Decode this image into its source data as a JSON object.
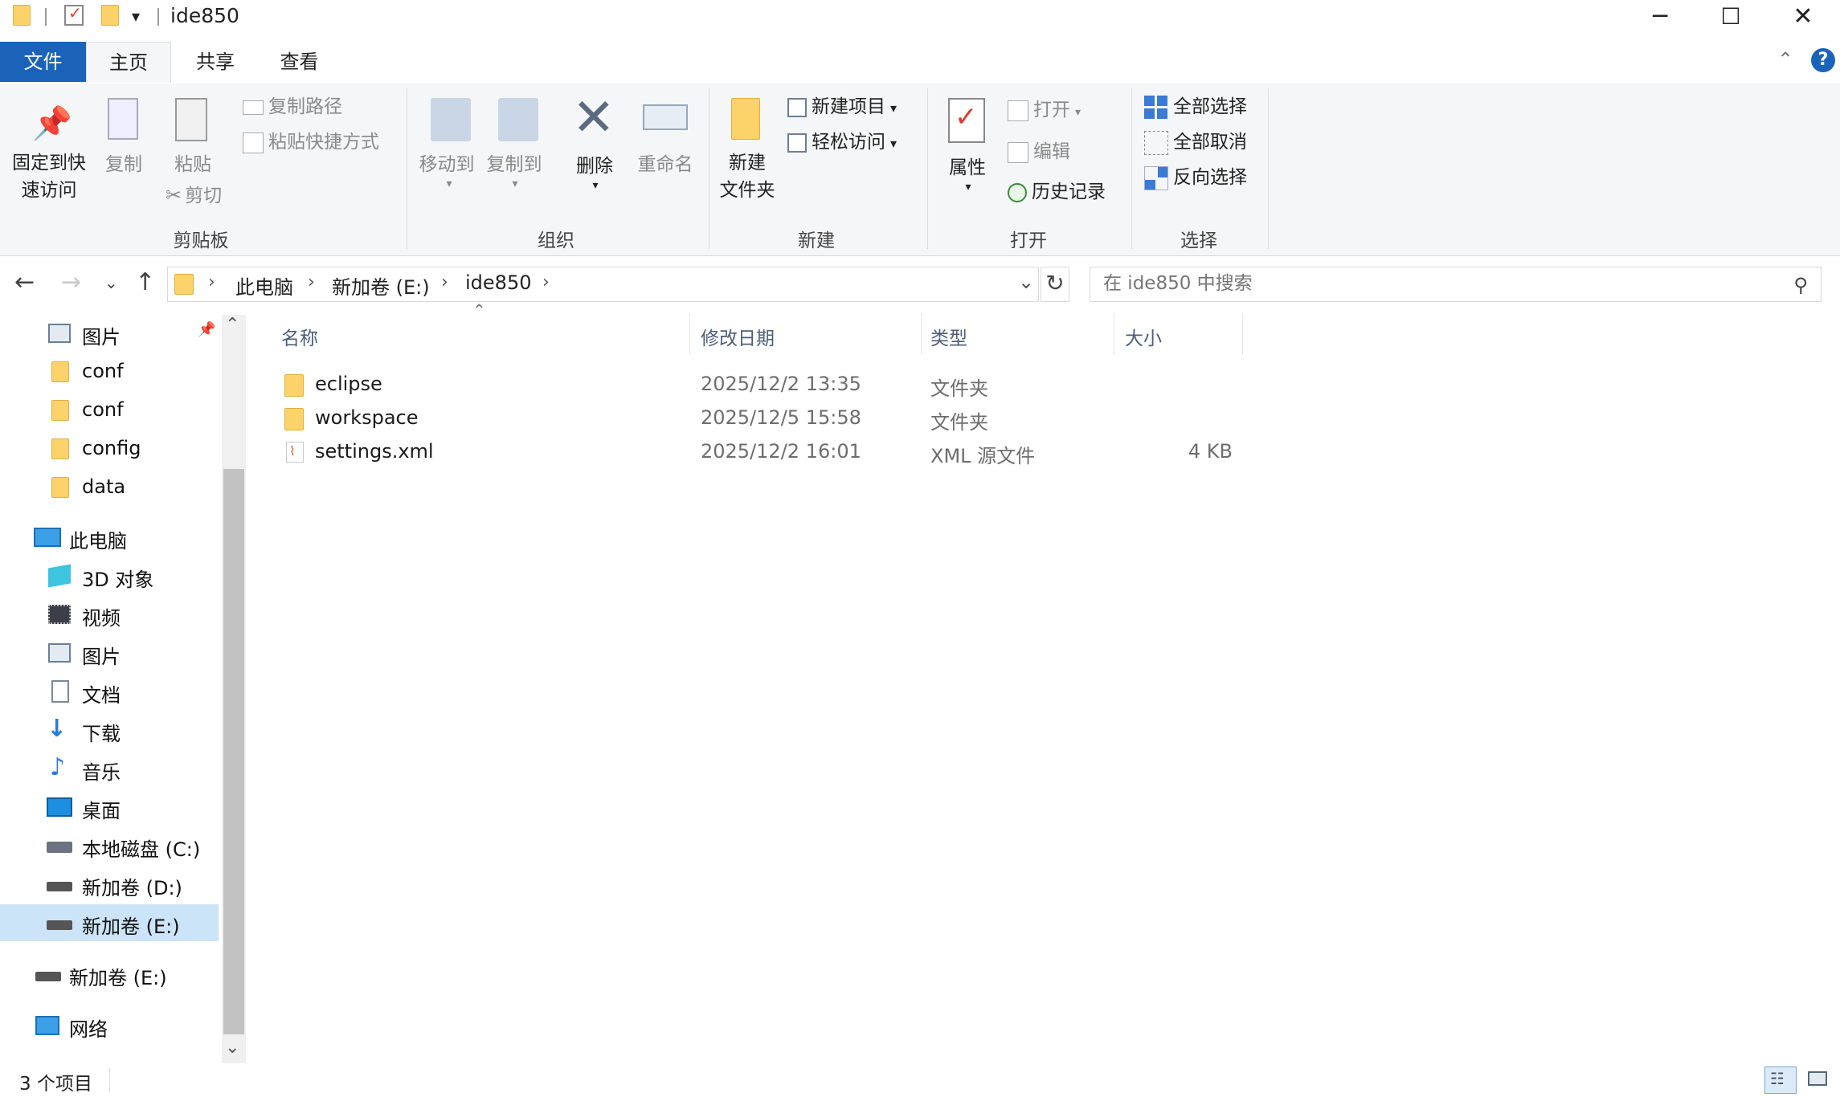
{
  "window": {
    "title": "ide850",
    "controls": {
      "minimize": "─",
      "maximize": "☐",
      "close": "✕"
    }
  },
  "ribbon_tabs": [
    "文件",
    "主页",
    "共享",
    "查看"
  ],
  "ribbon": {
    "clipboard": {
      "label": "剪贴板",
      "pin": "固定到快\n速访问",
      "pin_line1": "固定到快",
      "pin_line2": "速访问",
      "copy": "复制",
      "paste": "粘贴",
      "copy_path": "复制路径",
      "paste_shortcut": "粘贴快捷方式",
      "cut": "剪切"
    },
    "organize": {
      "label": "组织",
      "move_to": "移动到",
      "copy_to": "复制到",
      "delete": "删除",
      "rename": "重命名"
    },
    "new": {
      "label": "新建",
      "new_folder_line1": "新建",
      "new_folder_line2": "文件夹",
      "new_item": "新建项目",
      "easy_access": "轻松访问"
    },
    "open": {
      "label": "打开",
      "properties": "属性",
      "open": "打开",
      "edit": "编辑",
      "history": "历史记录"
    },
    "select": {
      "label": "选择",
      "select_all": "全部选择",
      "select_none": "全部取消",
      "invert": "反向选择"
    }
  },
  "address": {
    "crumbs": [
      "此电脑",
      "新加卷 (E:)",
      "ide850"
    ],
    "search_placeholder": "在 ide850 中搜索"
  },
  "nav_pane": {
    "quick": [
      "图片",
      "conf",
      "conf",
      "config",
      "data"
    ],
    "this_pc": "此电脑",
    "pc_items": [
      "3D 对象",
      "视频",
      "图片",
      "文档",
      "下载",
      "音乐",
      "桌面",
      "本地磁盘 (C:)",
      "新加卷 (D:)",
      "新加卷 (E:)"
    ],
    "drive_e": "新加卷 (E:)",
    "network": "网络"
  },
  "columns": {
    "name": "名称",
    "modified": "修改日期",
    "type": "类型",
    "size": "大小"
  },
  "files": [
    {
      "name": "eclipse",
      "modified": "2025/12/2 13:35",
      "type": "文件夹",
      "size": ""
    },
    {
      "name": "workspace",
      "modified": "2025/12/5 15:58",
      "type": "文件夹",
      "size": ""
    },
    {
      "name": "settings.xml",
      "modified": "2025/12/2 16:01",
      "type": "XML 源文件",
      "size": "4 KB"
    }
  ],
  "status": {
    "count": "3 个项目"
  },
  "colors": {
    "accent": "#1a63b8",
    "selected": "#cce4f7",
    "folder": "#fcd26a"
  }
}
